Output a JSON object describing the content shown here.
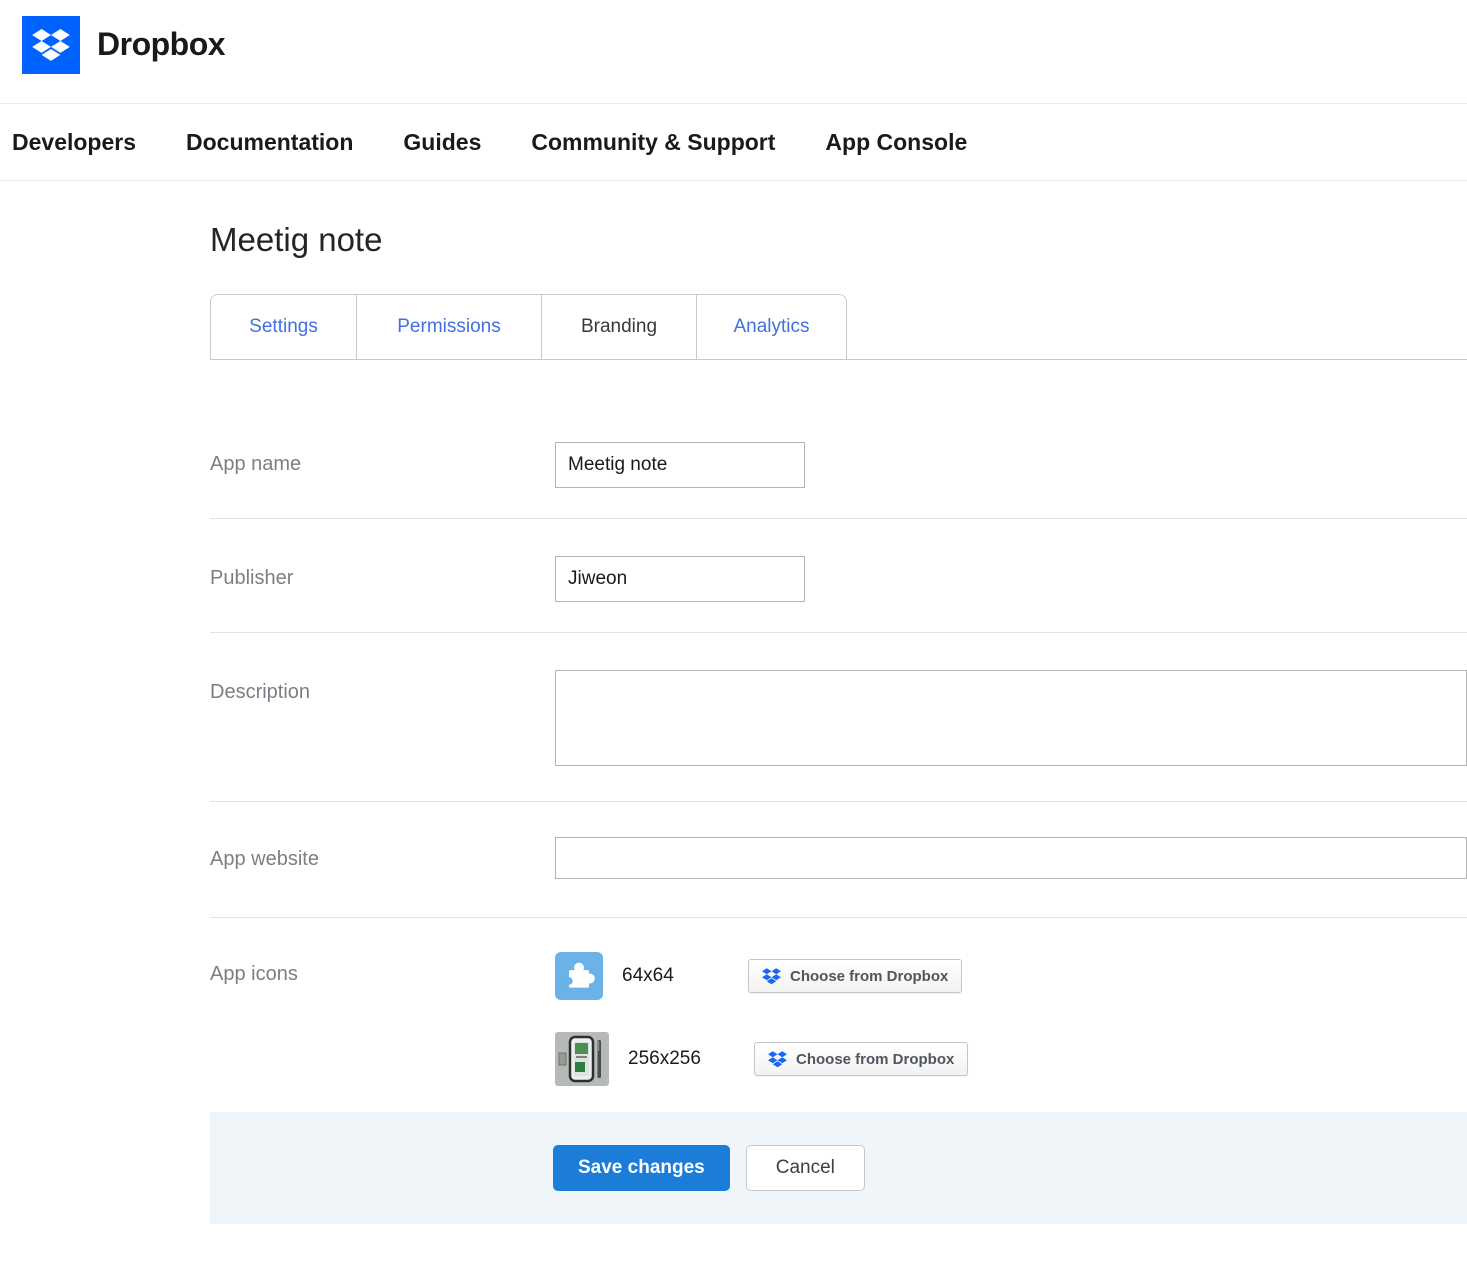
{
  "header": {
    "brand": "Dropbox"
  },
  "nav": {
    "items": [
      "Developers",
      "Documentation",
      "Guides",
      "Community & Support",
      "App Console"
    ]
  },
  "page": {
    "title": "Meetig note"
  },
  "tabs": {
    "items": [
      "Settings",
      "Permissions",
      "Branding",
      "Analytics"
    ],
    "active": "Branding"
  },
  "form": {
    "app_name": {
      "label": "App name",
      "value": "Meetig note"
    },
    "publisher": {
      "label": "Publisher",
      "value": "Jiweon"
    },
    "description": {
      "label": "Description",
      "value": ""
    },
    "app_website": {
      "label": "App website",
      "value": ""
    },
    "app_icons": {
      "label": "App icons",
      "small": {
        "size": "64x64",
        "button_label": "Choose from Dropbox",
        "icon": "puzzle-icon"
      },
      "large": {
        "size": "256x256",
        "button_label": "Choose from Dropbox",
        "icon": "phone-photo-thumbnail"
      }
    }
  },
  "footer": {
    "save_label": "Save changes",
    "cancel_label": "Cancel"
  },
  "colors": {
    "brand_blue": "#0062ff",
    "tab_link_blue": "#4270e0",
    "thumb_blue": "#6ab2e8",
    "button_glyph_blue": "#1a67f2",
    "save_blue": "#1b7dd8",
    "footer_bg": "#eff5f9"
  }
}
